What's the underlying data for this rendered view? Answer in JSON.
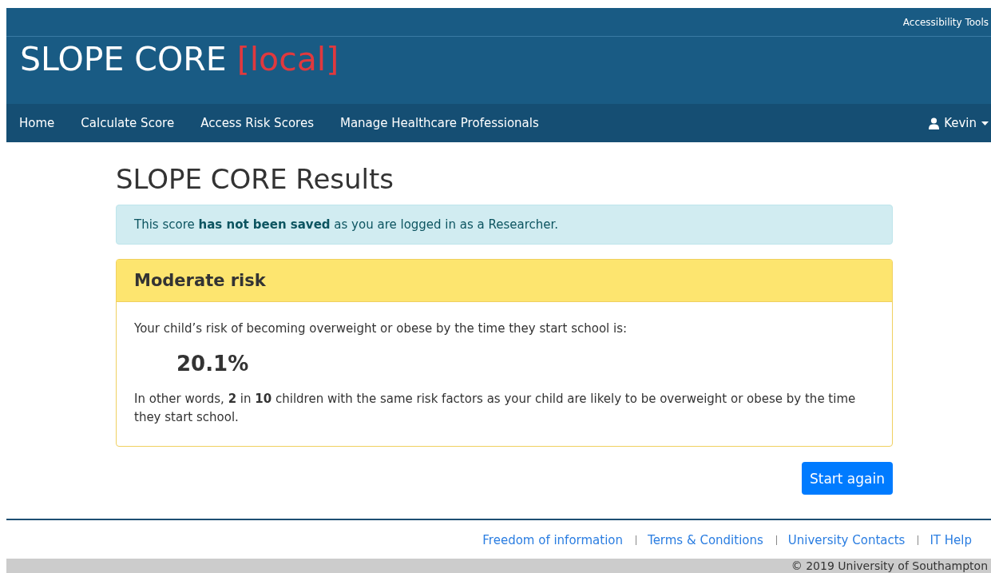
{
  "top_bar": {
    "link": "Accessibility Tools"
  },
  "brand": {
    "name": "SLOPE CORE",
    "tag": "[local]"
  },
  "nav": {
    "items": [
      {
        "label": "Home"
      },
      {
        "label": "Calculate Score"
      },
      {
        "label": "Access Risk Scores"
      },
      {
        "label": "Manage Healthcare Professionals"
      }
    ],
    "user": "Kevin"
  },
  "page_title": "SLOPE CORE Results",
  "alert": "This score **has not been saved** as you are logged in as a Researcher.",
  "result": {
    "heading": "Moderate risk",
    "intro": "Your child’s risk of becoming overweight or obese by the time they start school is:",
    "value": "20.1%",
    "explanation": "In other words, **2** in **10** children with the same risk factors as your child are likely to be overweight or obese by the time they start school."
  },
  "button": "Start again",
  "footer": {
    "links": [
      "Freedom of information",
      "Terms & Conditions",
      "University Contacts",
      "IT Help"
    ],
    "copyright": "© 2019 University of Southampton"
  }
}
